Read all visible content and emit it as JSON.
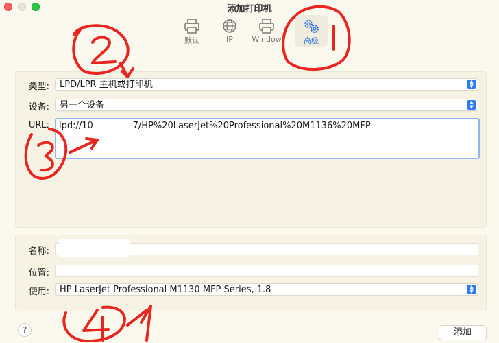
{
  "window": {
    "title": "添加打印机"
  },
  "toolbar": {
    "items": [
      {
        "label": "默认",
        "icon": "printer-icon"
      },
      {
        "label": "IP",
        "icon": "globe-icon"
      },
      {
        "label": "Window",
        "icon": "printer-icon"
      },
      {
        "label": "高级",
        "icon": "gears-icon"
      }
    ],
    "active": "高级"
  },
  "form": {
    "type_label": "类型:",
    "type_value": "LPD/LPR 主机或打印机",
    "device_label": "设备:",
    "device_value": "另一个设备",
    "url_label": "URL:",
    "url_value": "lpd://10              7/HP%20LaserJet%20Professional%20M1136%20MFP",
    "name_label": "名称:",
    "name_value": "",
    "location_label": "位置:",
    "location_value": "",
    "use_label": "使用:",
    "use_value": "HP LaserJet Professional M1130 MFP Series, 1.8"
  },
  "footer": {
    "help_label": "?",
    "add_label": "添加"
  },
  "colors": {
    "accent": "#2f7bf5",
    "annotation": "#e8261f",
    "background": "#fbf9ee"
  }
}
